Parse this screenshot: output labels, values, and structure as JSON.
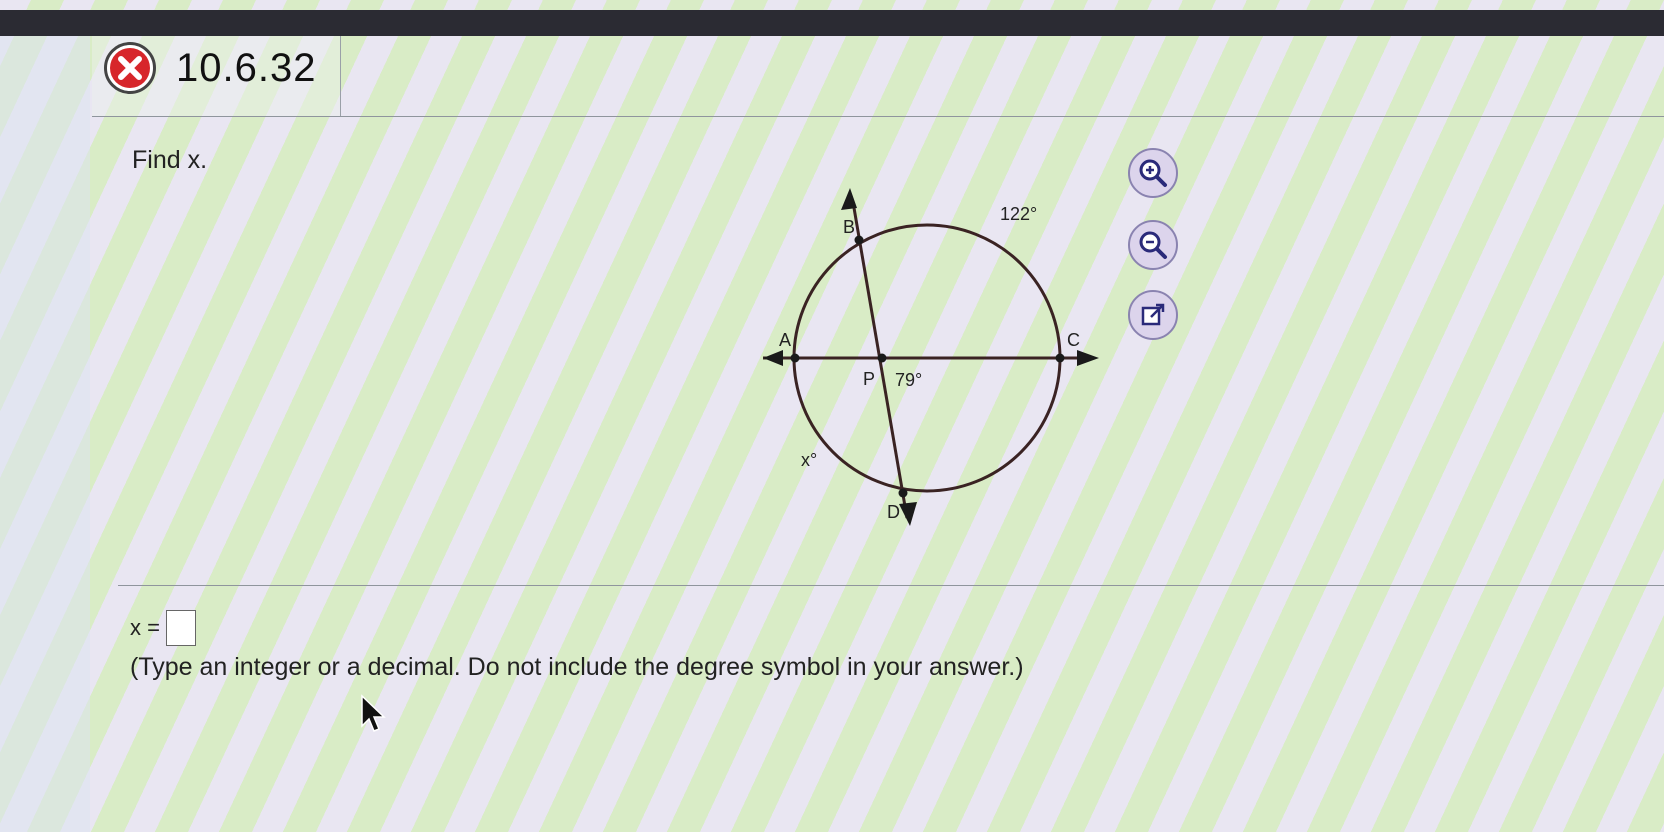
{
  "question": {
    "number": "10.6.32",
    "status_icon": "incorrect-x-icon",
    "prompt": "Find x."
  },
  "figure": {
    "points": {
      "A": "A",
      "B": "B",
      "C": "C",
      "D": "D",
      "P": "P"
    },
    "labels": {
      "arc_bc": "122°",
      "angle_p": "79°",
      "arc_ad": "x°"
    }
  },
  "tools": [
    {
      "icon": "zoom-in-icon"
    },
    {
      "icon": "zoom-out-icon"
    },
    {
      "icon": "open-new-window-icon"
    }
  ],
  "answer": {
    "label": "x =",
    "value": "",
    "instruction": "(Type an integer or a decimal. Do not include the degree symbol in your answer.)"
  },
  "colors": {
    "figure_line": "#3a2323",
    "tool_accent": "#2a2a7a",
    "incorrect_red": "#d7262b"
  }
}
